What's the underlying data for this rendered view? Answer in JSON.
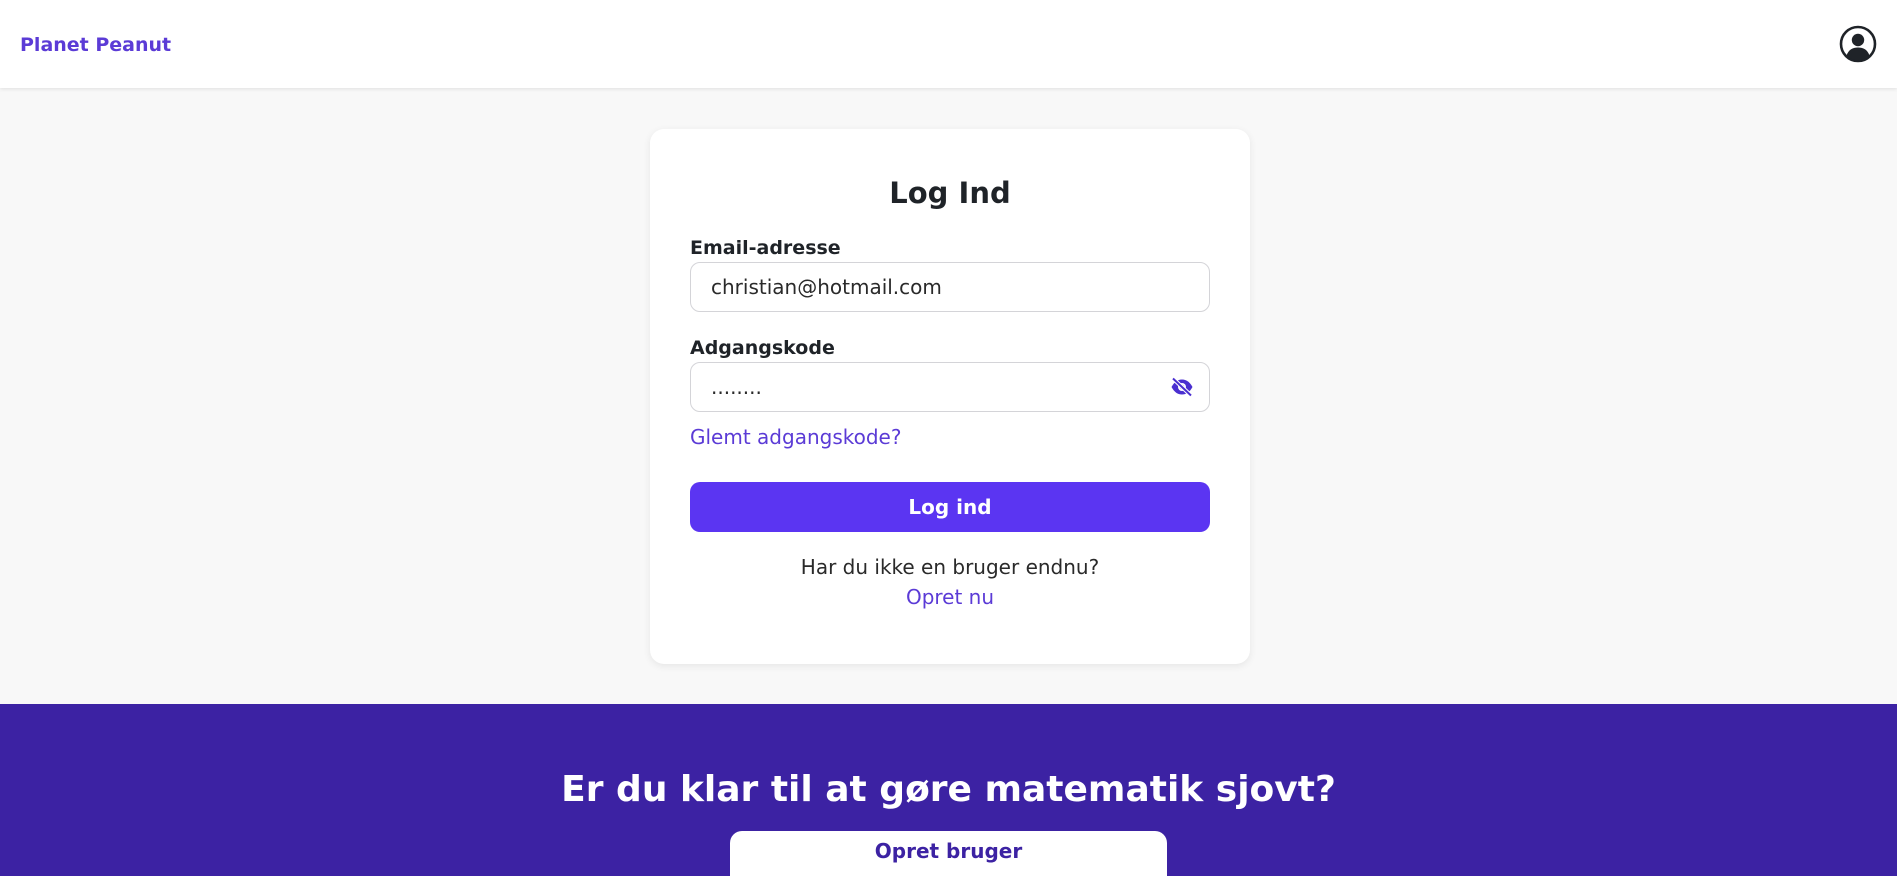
{
  "header": {
    "brand": "Planet Peanut",
    "account_icon": "user-circle-icon"
  },
  "login": {
    "title": "Log Ind",
    "email_label": "Email-adresse",
    "email_value": "christian@hotmail.com",
    "password_label": "Adgangskode",
    "password_value": "........",
    "password_toggle_icon": "eye-slash-icon",
    "forgot_link": "Glemt adgangskode?",
    "submit_label": "Log ind",
    "signup_prompt": "Har du ikke en bruger endnu?",
    "signup_link": "Opret nu"
  },
  "cta": {
    "title": "Er du klar til at gøre matematik sjovt?",
    "button_label": "Opret bruger"
  },
  "colors": {
    "accent": "#5b35f2",
    "brand_text": "#5b3bd6",
    "cta_background": "#3c22a3",
    "page_background": "#f8f8f8"
  }
}
